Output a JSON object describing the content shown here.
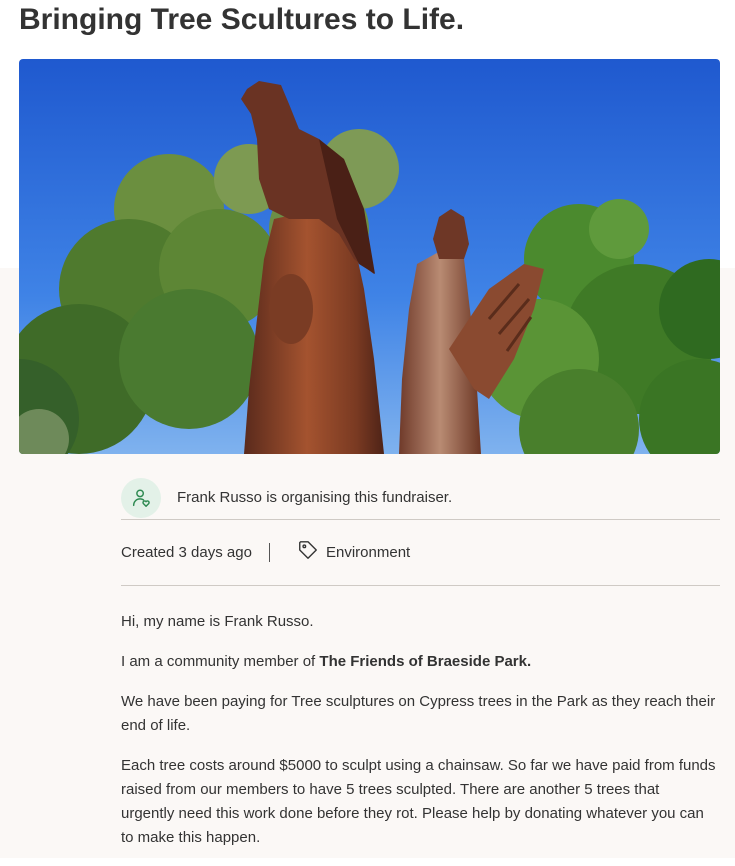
{
  "page": {
    "title": "Bringing Tree Scultures to Life."
  },
  "organiser": {
    "icon": "person-heart-icon",
    "text": "Frank Russo is organising this fundraiser."
  },
  "meta": {
    "created": "Created 3 days ago",
    "category_icon": "tag-icon",
    "category": "Environment"
  },
  "story": {
    "p1": "Hi, my name is Frank Russo.",
    "p2_prefix": "I am a community member of ",
    "p2_bold": "The Friends of Braeside Park.",
    "p3": "We have been paying for Tree sculptures on Cypress trees in the Park as they reach their end of life.",
    "p4": "Each tree costs around $5000 to sculpt using a chainsaw. So far we have paid from funds raised from our members to have 5 trees sculpted. There are another 5 trees that urgently need this work done before they rot. Please help by donating whatever you can to make this happen."
  },
  "colors": {
    "accent_green": "#2f8a52",
    "icon_bg": "#e3f1e8",
    "divider": "#cfcac5",
    "page_bg": "#fbf8f6"
  }
}
